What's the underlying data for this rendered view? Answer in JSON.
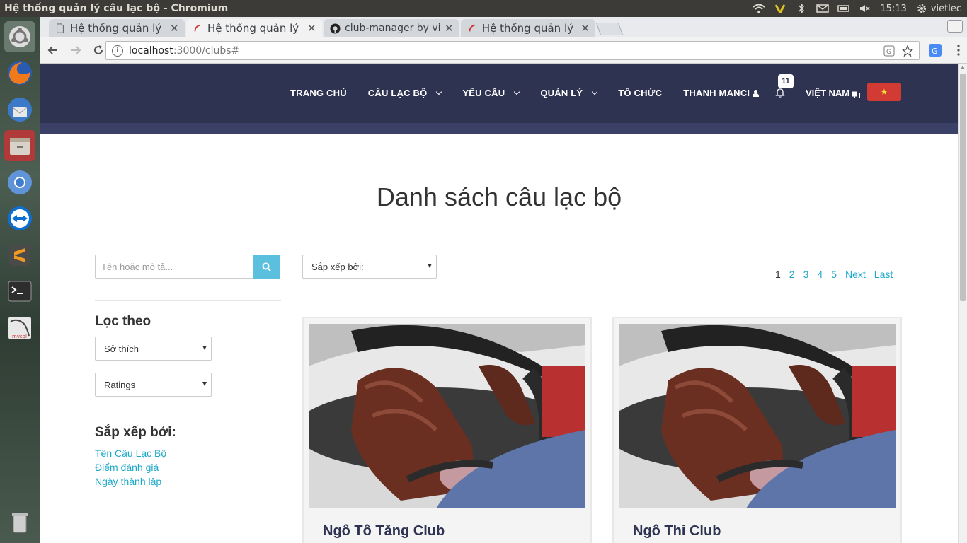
{
  "os": {
    "window_title": "Hệ thống quản lý câu lạc bộ - Chromium",
    "clock": "15:13",
    "user": "vietlec"
  },
  "launcher": {
    "items": [
      "dash-icon",
      "firefox-icon",
      "thunderbird-icon",
      "files-icon",
      "chromium-icon",
      "teamviewer-icon",
      "sublime-icon",
      "terminal-icon",
      "mysql-workbench-icon",
      "trash-icon"
    ]
  },
  "browser": {
    "tabs": [
      {
        "label": "Hệ thống quản lý",
        "active": false
      },
      {
        "label": "Hệ thống quản lý",
        "active": true
      },
      {
        "label": "club-manager by vi",
        "active": false
      },
      {
        "label": "Hệ thống quản lý",
        "active": false
      }
    ],
    "url_host": "localhost",
    "url_path": ":3000/clubs#"
  },
  "navbar": {
    "links": [
      {
        "label": "TRANG CHỦ",
        "dropdown": false
      },
      {
        "label": "CÂU LẠC BỘ",
        "dropdown": true
      },
      {
        "label": "YÊU CẦU",
        "dropdown": true
      },
      {
        "label": "QUẢN LÝ",
        "dropdown": true
      },
      {
        "label": "TỔ CHỨC",
        "dropdown": false
      },
      {
        "label": "THANH MANCI",
        "dropdown": false
      }
    ],
    "notification_count": "11",
    "language": "VIỆT NAM",
    "flag_star": "★",
    "colors": {
      "navbar": "#2e3352",
      "accent": "#5bc0de",
      "link": "#1ba9c9",
      "flag": "#d13b33"
    }
  },
  "main": {
    "title": "Danh sách câu lạc bộ",
    "search": {
      "placeholder": "Tên hoặc mô tả..."
    },
    "sort_select": {
      "value": "Sắp xếp bởi:"
    },
    "filter": {
      "heading": "Lọc theo",
      "hobby_select": "Sở thích",
      "ratings_select": "Ratings"
    },
    "sort": {
      "heading": "Sắp xếp bởi:",
      "links": [
        "Tên Câu Lạc Bộ",
        "Điểm đánh giá",
        "Ngày thành lập"
      ]
    },
    "pagination": {
      "current": "1",
      "pages": [
        "2",
        "3",
        "4",
        "5"
      ],
      "next": "Next",
      "last": "Last"
    },
    "clubs": [
      {
        "name": "Ngô Tô Tăng Club"
      },
      {
        "name": "Ngô Thi Club"
      }
    ]
  }
}
